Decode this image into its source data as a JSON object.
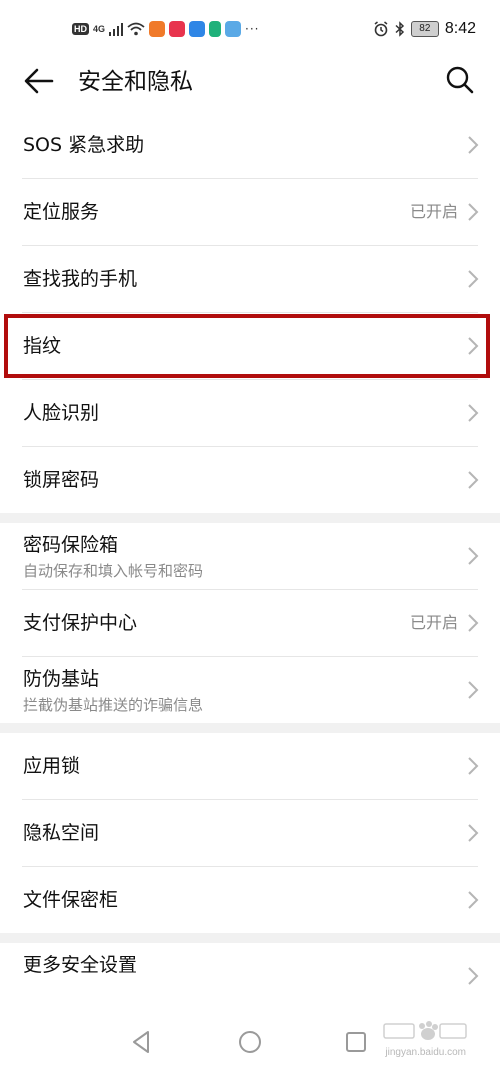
{
  "status_bar": {
    "hd_label": "HD",
    "network_label": "4G",
    "battery_level": "82",
    "time": "8:42",
    "overflow_dots": "···"
  },
  "header": {
    "title": "安全和隐私"
  },
  "sections": [
    {
      "items": [
        {
          "label": "SOS 紧急求助"
        },
        {
          "label": "定位服务",
          "status": "已开启"
        },
        {
          "label": "查找我的手机"
        },
        {
          "label": "指纹"
        },
        {
          "label": "人脸识别"
        },
        {
          "label": "锁屏密码"
        }
      ]
    },
    {
      "items": [
        {
          "label": "密码保险箱",
          "subtitle": "自动保存和填入帐号和密码"
        },
        {
          "label": "支付保护中心",
          "status": "已开启"
        },
        {
          "label": "防伪基站",
          "subtitle": "拦截伪基站推送的诈骗信息"
        }
      ]
    },
    {
      "items": [
        {
          "label": "应用锁"
        },
        {
          "label": "隐私空间"
        },
        {
          "label": "文件保密柜"
        }
      ]
    },
    {
      "items": [
        {
          "label": "更多安全设置"
        }
      ]
    }
  ],
  "colors": {
    "highlight_border": "#b10d0d",
    "section_gap": "#f1f1f1",
    "secondary_text": "#8a8a8a"
  },
  "watermark": {
    "url_text": "jingyan.baidu.com"
  }
}
